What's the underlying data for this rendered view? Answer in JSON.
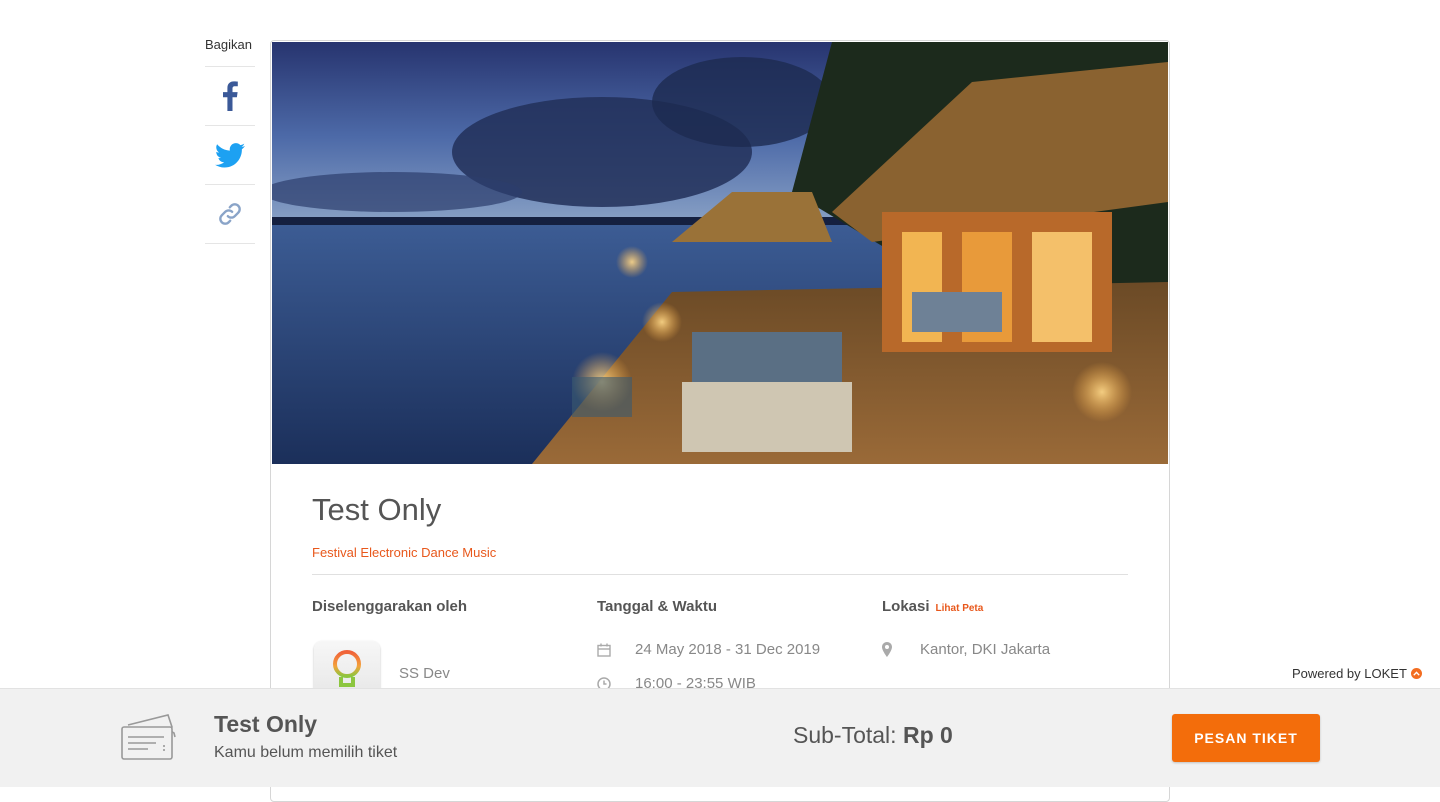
{
  "share": {
    "label": "Bagikan",
    "items": [
      {
        "icon": "facebook-icon",
        "color": "#3b5998"
      },
      {
        "icon": "twitter-icon",
        "color": "#1da1f2"
      },
      {
        "icon": "link-icon",
        "color": "#8aa4c8"
      }
    ]
  },
  "event": {
    "banner_image": "resort-at-dusk-photo",
    "title": "Test Only",
    "category": "Festival Electronic Dance Music",
    "organizer_heading": "Diselenggarakan oleh",
    "organizer_name": "SS Dev",
    "datetime_heading": "Tanggal & Waktu",
    "date_range": "24 May 2018 - 31 Dec 2019",
    "time_range": "16:00 - 23:55 WIB",
    "location_heading": "Lokasi",
    "map_link": "Lihat Peta",
    "location": "Kantor, DKI Jakarta"
  },
  "powered_by": "Powered by LOKET",
  "bottom_bar": {
    "title": "Test Only",
    "subtitle": "Kamu belum memilih tiket",
    "subtotal_label": "Sub-Total:",
    "subtotal_value": "Rp 0",
    "order_button": "PESAN TIKET"
  },
  "colors": {
    "accent": "#f36d0b",
    "category_text": "#e8581c"
  }
}
